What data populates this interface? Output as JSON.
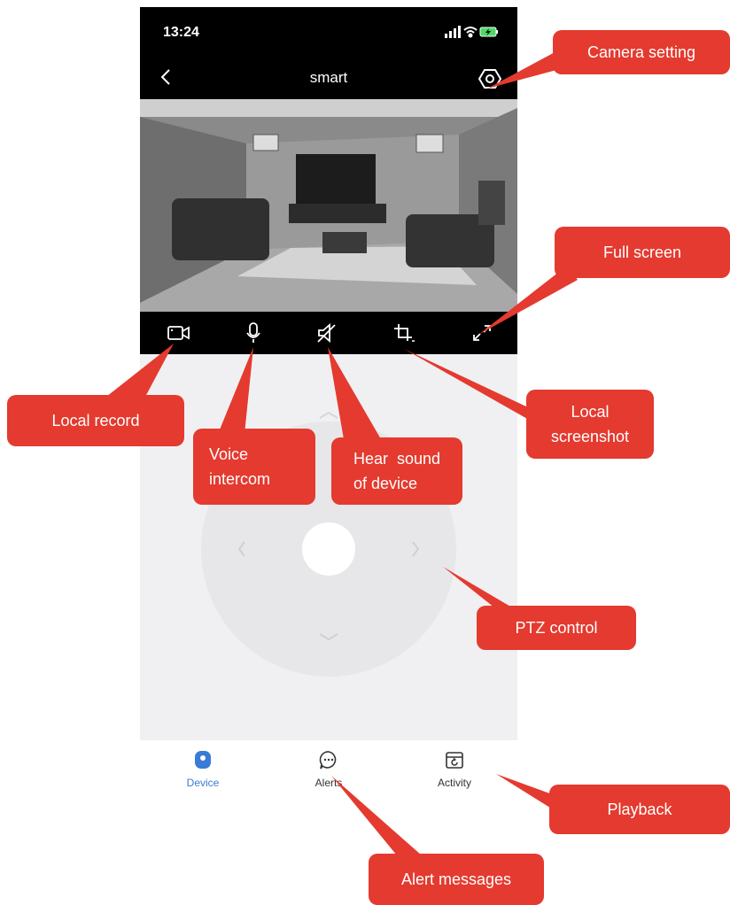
{
  "status_bar": {
    "time": "13:24"
  },
  "nav": {
    "title": "smart"
  },
  "toolbar": {
    "icons": [
      "video-record-icon",
      "microphone-icon",
      "mute-speaker-icon",
      "crop-screenshot-icon",
      "fullscreen-icon"
    ]
  },
  "tabs": [
    {
      "label": "Device",
      "icon": "device-icon",
      "active": true
    },
    {
      "label": "Alerts",
      "icon": "chat-bubble-icon",
      "active": false
    },
    {
      "label": "Activity",
      "icon": "calendar-playback-icon",
      "active": false
    }
  ],
  "callouts": {
    "camera_setting": "Camera setting",
    "full_screen": "Full screen",
    "local_record": "Local record",
    "voice_intercom_1": "Voice",
    "voice_intercom_2": "intercom",
    "hear_sound_1": "Hear  sound",
    "hear_sound_2": "of device",
    "local_screenshot_1": "Local",
    "local_screenshot_2": "screenshot",
    "ptz_control": "PTZ control",
    "playback": "Playback",
    "alert_messages": "Alert messages"
  },
  "colors": {
    "callout": "#e43a2f",
    "active_tab": "#3a7bd5",
    "bar": "#000000"
  }
}
